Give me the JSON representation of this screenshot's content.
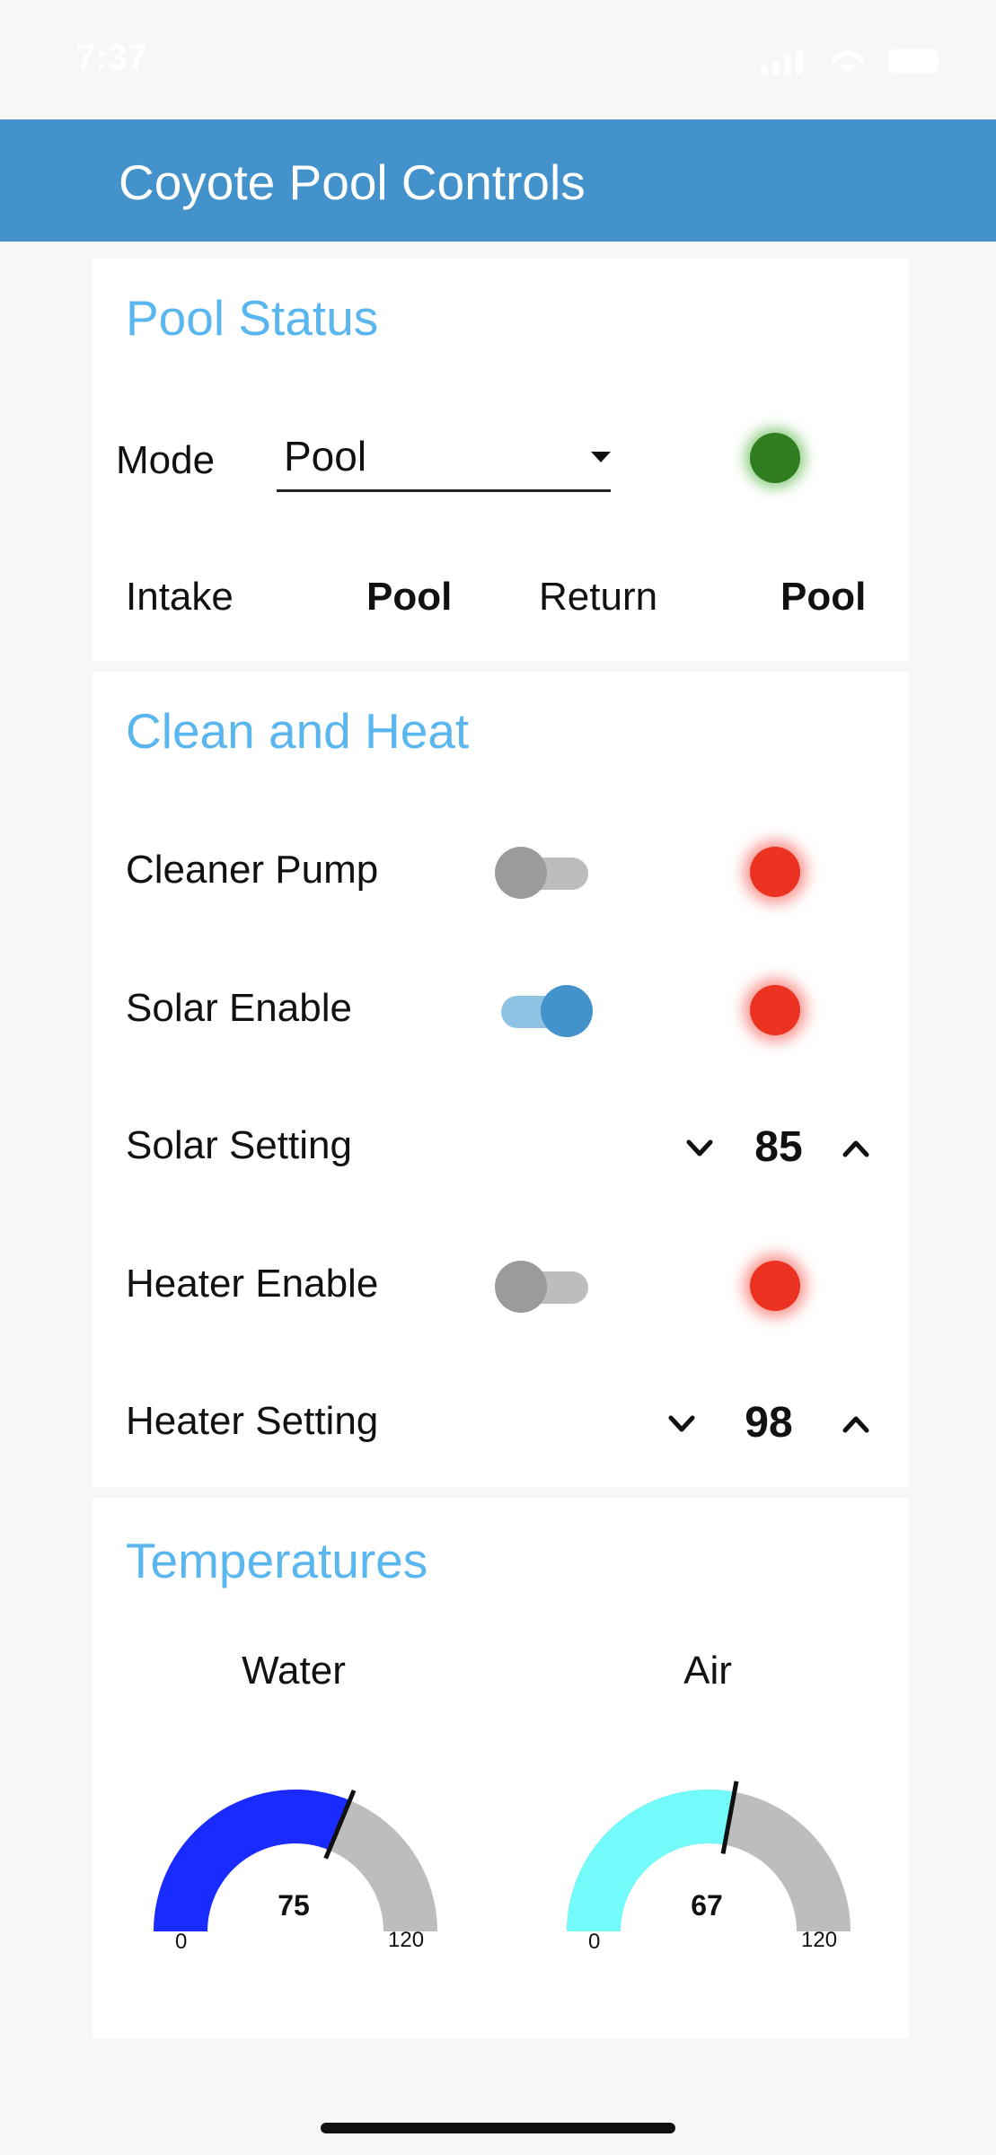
{
  "status_bar": {
    "time": "7:37"
  },
  "app_bar": {
    "title": "Coyote Pool Controls"
  },
  "pool_status": {
    "title": "Pool Status",
    "mode_label": "Mode",
    "mode_value": "Pool",
    "mode_led_color": "#2f7d1f",
    "intake_label": "Intake",
    "intake_value": "Pool",
    "return_label": "Return",
    "return_value": "Pool"
  },
  "clean_heat": {
    "title": "Clean and Heat",
    "cleaner_pump": {
      "label": "Cleaner Pump",
      "enabled": false,
      "led_color": "#ec3322"
    },
    "solar_enable": {
      "label": "Solar Enable",
      "enabled": true,
      "led_color": "#ec3322"
    },
    "solar_setting": {
      "label": "Solar Setting",
      "value": "85"
    },
    "heater_enable": {
      "label": "Heater Enable",
      "enabled": false,
      "led_color": "#ec3322"
    },
    "heater_setting": {
      "label": "Heater Setting",
      "value": "98"
    }
  },
  "temperatures": {
    "title": "Temperatures",
    "gauges": [
      {
        "label": "Water",
        "value": 75,
        "value_text": "75",
        "min": 0,
        "min_text": "0",
        "max": 120,
        "max_text": "120",
        "color": "#1a2bff"
      },
      {
        "label": "Air",
        "value": 67,
        "value_text": "67",
        "min": 0,
        "min_text": "0",
        "max": 120,
        "max_text": "120",
        "color": "#73fbfa"
      }
    ]
  },
  "colors": {
    "accent": "#4392cb",
    "section_title": "#5ab6ee",
    "gauge_background": "#bdbdbd"
  }
}
